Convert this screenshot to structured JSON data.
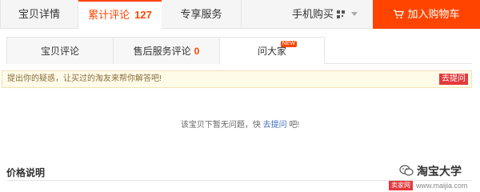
{
  "top_tabs": {
    "details": "宝贝详情",
    "reviews_label": "累计评论",
    "reviews_count": "127",
    "exclusive": "专享服务",
    "mobile_buy": "手机购买"
  },
  "cart_button": "加入购物车",
  "sub_tabs": {
    "item_reviews": "宝贝评论",
    "after_sales_label": "售后服务评论",
    "after_sales_count": "0",
    "ask_everyone": "问大家",
    "new_badge": "NEW"
  },
  "notice": {
    "text": "提出你的疑惑，让买过的淘友来帮你解答吧!",
    "ask_button": "去提问"
  },
  "empty_state": {
    "prefix": "该宝贝下暂无问题，快 ",
    "link": "去提问",
    "suffix": " 吧!"
  },
  "price_section": {
    "title": "价格说明"
  },
  "watermark": {
    "name": "淘宝大学",
    "badge": "卖家网",
    "url": "www.maijia.com"
  },
  "colors": {
    "accent": "#ff4400",
    "notice_bg": "#fffbe9",
    "link": "#3d6fb6"
  }
}
